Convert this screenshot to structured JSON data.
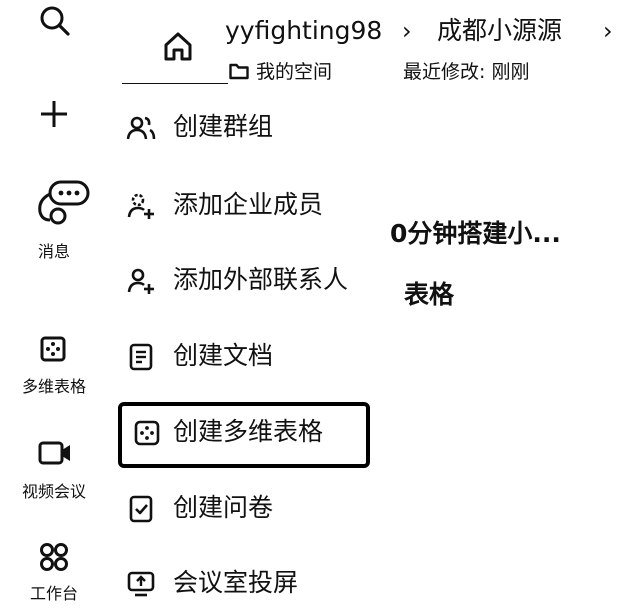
{
  "rail": {
    "messages_label": "消息",
    "multitable_label": "多维表格",
    "video_meeting_label": "视频会议",
    "workbench_label": "工作台"
  },
  "header": {
    "breadcrumb_user": "yyfighting98",
    "breadcrumb_doc": "成都小源源",
    "location_label": "我的空间",
    "modified_label": "最近修改: 刚刚"
  },
  "background": {
    "doc_title_fragment": "0分钟搭建小...",
    "doc_subtitle_fragment": "表格"
  },
  "menu": {
    "items": [
      {
        "label": "创建群组",
        "icon": "group-icon"
      },
      {
        "label": "添加企业成员",
        "icon": "add-member-icon"
      },
      {
        "label": "添加外部联系人",
        "icon": "add-contact-icon"
      },
      {
        "label": "创建文档",
        "icon": "document-icon"
      },
      {
        "label": "创建多维表格",
        "icon": "multitable-icon",
        "selected": true
      },
      {
        "label": "创建问卷",
        "icon": "survey-icon"
      },
      {
        "label": "会议室投屏",
        "icon": "screen-cast-icon"
      }
    ]
  }
}
